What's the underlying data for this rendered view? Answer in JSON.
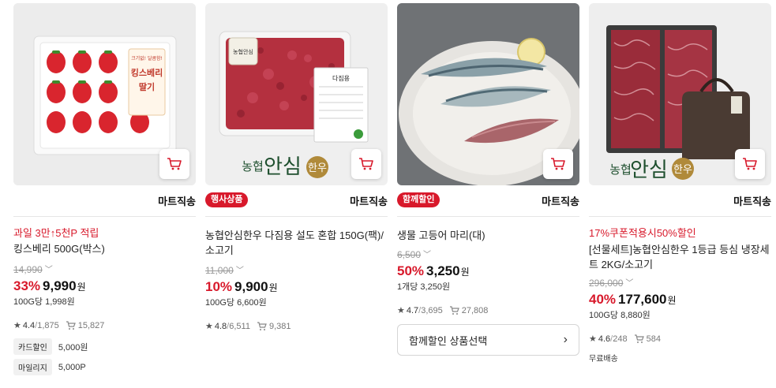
{
  "products": [
    {
      "delivery": "마트직송",
      "promo": "과일 3만↑5천P 적립",
      "name": "킹스베리 500G(박스)",
      "original_price": "14,990",
      "discount": "33%",
      "price": "9,990",
      "won": "원",
      "unit_price": "100G당 1,998원",
      "rating": "4.4",
      "review_count": "1,875",
      "likes": "15,827",
      "benefits": [
        {
          "tag": "카드할인",
          "value": "5,000원"
        },
        {
          "tag": "마일리지",
          "value": "5,000P"
        }
      ]
    },
    {
      "badge": "행사상품",
      "delivery": "마트직송",
      "name": "농협안심한우 다짐용 설도 혼합 150G(팩)/소고기",
      "original_price": "11,000",
      "discount": "10%",
      "price": "9,900",
      "won": "원",
      "unit_price": "100G당 6,600원",
      "rating": "4.8",
      "review_count": "6,511",
      "likes": "9,381",
      "brand_text": "농협",
      "brand_big": "안심",
      "brand_suffix": "한우"
    },
    {
      "badge": "함께할인",
      "delivery": "마트직송",
      "name": "생물 고등어 마리(대)",
      "original_price": "6,500",
      "discount": "50%",
      "price": "3,250",
      "won": "원",
      "unit_price": "1개당 3,250원",
      "rating": "4.7",
      "review_count": "3,695",
      "likes": "27,808",
      "combo_button": "함께할인 상품선택"
    },
    {
      "delivery": "마트직송",
      "promo": "17%쿠폰적용시50%할인",
      "name": "[선물세트]농협안심한우 1등급 등심 냉장세트 2KG/소고기",
      "original_price": "296,000",
      "discount": "40%",
      "price": "177,600",
      "won": "원",
      "unit_price": "100G당 8,880원",
      "rating": "4.6",
      "review_count": "248",
      "likes": "584",
      "free_shipping": "무료배송",
      "brand_text": "농협",
      "brand_big": "안심",
      "brand_suffix": "한우"
    }
  ],
  "strawberry_label_top": "크기없! 달콤함!",
  "strawberry_label_main": "킹스베리",
  "strawberry_label_sub": "딸기",
  "meat_label": "다짐용",
  "meat_brand": "농협안심",
  "colors": {
    "accent": "#d8192b"
  }
}
